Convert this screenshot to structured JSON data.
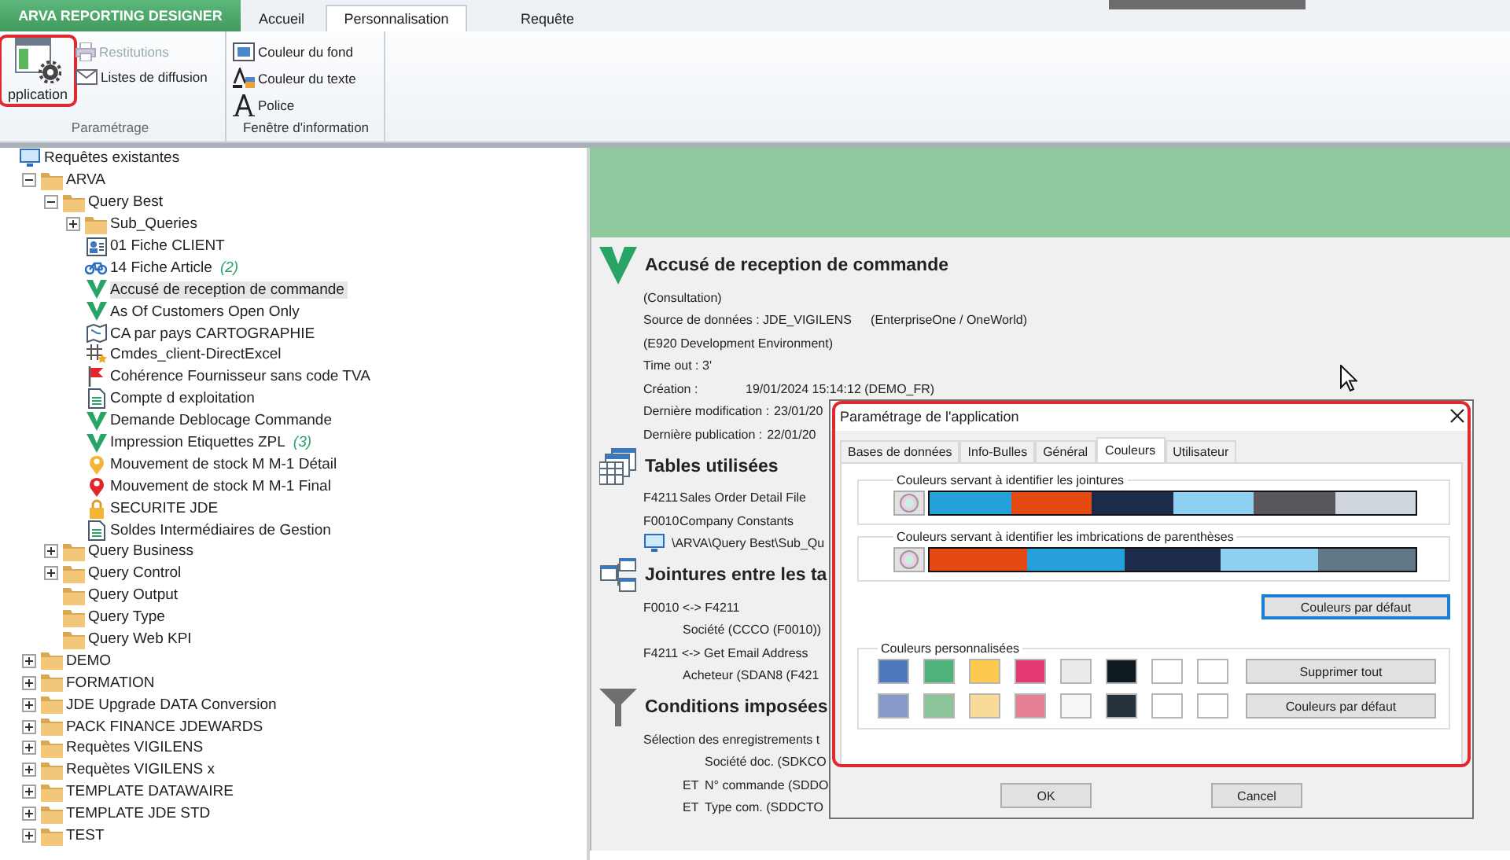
{
  "ribbon": {
    "app_tab": "ARVA REPORTING DESIGNER",
    "tabs": [
      {
        "label": "Accueil",
        "selected": false
      },
      {
        "label": "Personnalisation",
        "selected": true
      },
      {
        "label": "Requête",
        "selected": false
      }
    ],
    "groups": [
      {
        "label": "Paramétrage",
        "large_button": {
          "label": "pplication",
          "highlighted": true
        },
        "buttons": [
          {
            "label": "Restitutions",
            "kind": "printer",
            "disabled": true
          },
          {
            "label": "Listes de diffusion",
            "kind": "envelope",
            "disabled": false
          }
        ]
      },
      {
        "label": "Fenêtre d'information",
        "buttons": [
          {
            "label": "Couleur du fond",
            "kind": "fill",
            "disabled": false
          },
          {
            "label": "Couleur du texte",
            "kind": "text-color",
            "disabled": false
          },
          {
            "label": "Police",
            "kind": "font",
            "disabled": false
          }
        ]
      }
    ]
  },
  "tree": {
    "items": [
      {
        "label": "Requêtes existantes",
        "kind": "monitor",
        "selected": false,
        "children": [
          {
            "label": "ARVA",
            "kind": "folder",
            "selected": false,
            "expanded": true,
            "children": [
              {
                "label": "Query Best",
                "kind": "folder",
                "selected": false,
                "expanded": true,
                "children": [
                  {
                    "label": "Sub_Queries",
                    "kind": "folder",
                    "selected": false,
                    "expanded": false
                  },
                  {
                    "label": "01 Fiche CLIENT",
                    "kind": "card",
                    "selected": false
                  },
                  {
                    "label": "14 Fiche Article",
                    "count": "(2)",
                    "kind": "bike",
                    "selected": false
                  },
                  {
                    "label": "Accusé de reception de commande",
                    "kind": "v",
                    "selected": true
                  },
                  {
                    "label": "As Of Customers Open Only",
                    "kind": "v",
                    "selected": false
                  },
                  {
                    "label": "CA par pays CARTOGRAPHIE",
                    "kind": "map",
                    "selected": false
                  },
                  {
                    "label": "Cmdes_client-DirectExcel",
                    "kind": "gridstar",
                    "selected": false
                  },
                  {
                    "label": "Cohérence Fournisseur sans code TVA",
                    "kind": "flag",
                    "selected": false
                  },
                  {
                    "label": "Compte d exploitation",
                    "kind": "doc",
                    "selected": false
                  },
                  {
                    "label": "Demande Deblocage Commande",
                    "kind": "v",
                    "selected": false
                  },
                  {
                    "label": "Impression Etiquettes ZPL",
                    "count": "(3)",
                    "kind": "v",
                    "selected": false
                  },
                  {
                    "label": "Mouvement de stock M M-1 Détail",
                    "kind": "pin-yellow",
                    "selected": false
                  },
                  {
                    "label": "Mouvement de stock M M-1 Final",
                    "kind": "pin-red",
                    "selected": false
                  },
                  {
                    "label": "SECURITE JDE",
                    "kind": "lock",
                    "selected": false
                  },
                  {
                    "label": "Soldes Intermédiaires de Gestion",
                    "kind": "doc",
                    "selected": false
                  }
                ]
              },
              {
                "label": "Query Business",
                "kind": "folder",
                "selected": false,
                "expanded": false
              },
              {
                "label": "Query Control",
                "kind": "folder",
                "selected": false,
                "expanded": false
              },
              {
                "label": "Query Output",
                "kind": "folder",
                "selected": false
              },
              {
                "label": "Query Type",
                "kind": "folder",
                "selected": false
              },
              {
                "label": "Query Web KPI",
                "kind": "folder",
                "selected": false
              }
            ]
          },
          {
            "label": "DEMO",
            "kind": "folder",
            "selected": false,
            "expanded": false
          },
          {
            "label": "FORMATION",
            "kind": "folder",
            "selected": false,
            "expanded": false
          },
          {
            "label": "JDE Upgrade DATA Conversion",
            "kind": "folder",
            "selected": false,
            "expanded": false
          },
          {
            "label": "PACK FINANCE JDEWARDS",
            "kind": "folder",
            "selected": false,
            "expanded": false
          },
          {
            "label": "Requètes VIGILENS",
            "kind": "folder",
            "selected": false,
            "expanded": false
          },
          {
            "label": "Requètes VIGILENS x",
            "kind": "folder",
            "selected": false,
            "expanded": false
          },
          {
            "label": "TEMPLATE DATAWAIRE",
            "kind": "folder",
            "selected": false,
            "expanded": false
          },
          {
            "label": "TEMPLATE JDE STD",
            "kind": "folder",
            "selected": false,
            "expanded": false
          },
          {
            "label": "TEST",
            "kind": "folder",
            "selected": false,
            "expanded": false
          }
        ]
      }
    ]
  },
  "detail": {
    "sections": [
      {
        "kind": "v",
        "title": "Accusé de reception de commande",
        "lines": [
          {
            "kind": "plain",
            "text": "(Consultation)"
          },
          {
            "kind": "plain",
            "text": "Source de données : JDE_VIGILENS",
            "note": "(EnterpriseOne / OneWorld)"
          },
          {
            "kind": "plain",
            "text": "(E920 Development Environment)"
          },
          {
            "kind": "plain",
            "text": "Time out : 3'"
          },
          {
            "kind": "field",
            "text": "Création :",
            "value": "19/01/2024 15:14:12 (DEMO_FR)"
          },
          {
            "kind": "field",
            "text": "Dernière modification :",
            "value": "23/01/20"
          },
          {
            "kind": "field",
            "text": "Dernière publication :",
            "value": "22/01/20"
          }
        ]
      },
      {
        "kind": "tables",
        "title": "Tables utilisées",
        "lines": [
          {
            "kind": "code",
            "text": "F4211",
            "value": "Sales Order Detail File"
          },
          {
            "kind": "code",
            "text": "F0010",
            "value": "Company Constants"
          },
          {
            "kind": "path",
            "text": "\\ARVA\\Query Best\\Sub_Qu"
          }
        ]
      },
      {
        "kind": "joins",
        "title": "Jointures entre les ta",
        "lines": [
          {
            "kind": "plain",
            "text": "F0010 <-> F4211",
            "children": [
              {
                "kind": "plain",
                "text": "Société (CCCO (F0010))"
              }
            ]
          },
          {
            "kind": "plain",
            "text": "F4211 <-> Get Email Address",
            "children": [
              {
                "kind": "plain",
                "text": "Acheteur (SDAN8 (F421"
              }
            ]
          }
        ]
      },
      {
        "kind": "funnel",
        "title": "Conditions imposées",
        "lines": [
          {
            "kind": "plain",
            "text": "Sélection des enregistrements t",
            "children": [
              {
                "kind": "condition",
                "text": "Société doc. (SDKCO"
              },
              {
                "kind": "condition",
                "operator": "ET",
                "text": "N° commande (SDDO"
              },
              {
                "kind": "condition",
                "operator": "ET",
                "text": "Type com. (SDDCTO"
              }
            ]
          }
        ]
      }
    ]
  },
  "dialog": {
    "title": "Paramétrage de l'application",
    "highlighted": true,
    "tabs": [
      {
        "label": "Bases de données",
        "selected": false
      },
      {
        "label": "Info-Bulles",
        "selected": false
      },
      {
        "label": "Général",
        "selected": false
      },
      {
        "label": "Couleurs",
        "selected": true
      },
      {
        "label": "Utilisateur",
        "selected": false
      }
    ],
    "join_group": {
      "label": "Couleurs servant à identifier les jointures",
      "colors": [
        {
          "color": "#26a0da"
        },
        {
          "color": "#e64a14"
        },
        {
          "color": "#1c2a4c"
        },
        {
          "color": "#8fd0f0"
        },
        {
          "color": "#5a575c"
        },
        {
          "color": "#ced5dc"
        }
      ]
    },
    "paren_group": {
      "label": "Couleurs servant à identifier les imbrications de parenthèses",
      "colors": [
        {
          "color": "#e64a14"
        },
        {
          "color": "#26a0da"
        },
        {
          "color": "#1c2a4c"
        },
        {
          "color": "#8fd0f0"
        },
        {
          "color": "#607888"
        }
      ]
    },
    "default_button": {
      "label": "Couleurs par défaut",
      "focused": true
    },
    "custom_group": {
      "label": "Couleurs personnalisées",
      "rows": [
        {
          "button": "Supprimer tout",
          "swatches": [
            {
              "color": "#4e79bc"
            },
            {
              "color": "#4db37a"
            },
            {
              "color": "#fdc94e"
            },
            {
              "color": "#e33a74"
            },
            {
              "color": "#ebebeb"
            },
            {
              "color": "#0e1a1f"
            },
            {
              "color": "#ffffff"
            },
            {
              "color": "#ffffff"
            }
          ]
        },
        {
          "button": "Couleurs par défaut",
          "swatches": [
            {
              "color": "#8699c9"
            },
            {
              "color": "#8dc59a"
            },
            {
              "color": "#f8db98"
            },
            {
              "color": "#e57f94"
            },
            {
              "color": "#f7f7f7"
            },
            {
              "color": "#26323c"
            },
            {
              "color": "#ffffff"
            },
            {
              "color": "#ffffff"
            }
          ]
        }
      ]
    },
    "buttons": [
      "OK",
      "Cancel"
    ]
  }
}
